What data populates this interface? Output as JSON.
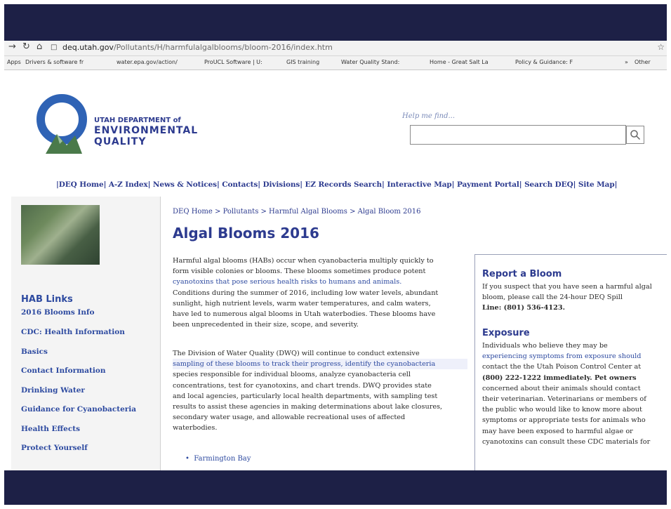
{
  "browser": {
    "url_host": "deq.utah.gov",
    "url_path": "/Pollutants/H/harmfulalgalblooms/bloom-2016/index.htm",
    "bookmarks": [
      "Apps",
      "Drivers & software fr",
      "water.epa.gov/action/",
      "ProUCL Software | U:",
      "GIS training",
      "Water Quality Stand:",
      "Home - Great Salt La",
      "Policy & Guidance: F",
      "»",
      "Other"
    ]
  },
  "header": {
    "org_line1": "UTAH DEPARTMENT of",
    "org_line2": "ENVIRONMENTAL",
    "org_line3": "QUALITY",
    "help_label": "Help me find...",
    "brand_color": "#2d3b8f"
  },
  "nav": {
    "items": [
      "DEQ Home",
      "A-Z Index",
      "News & Notices",
      "Contacts",
      "Divisions",
      "EZ Records Search",
      "Interactive Map",
      "Payment Portal",
      "Search DEQ",
      "Site Map"
    ]
  },
  "sidebar": {
    "title": "HAB Links",
    "links": [
      "2016 Blooms Info",
      "CDC: Health Information",
      "Basics",
      "Contact Information",
      "Drinking Water",
      "Guidance for Cyanobacteria",
      "Health Effects",
      "Protect Yourself"
    ]
  },
  "main": {
    "breadcrumb": "DEQ Home > Pollutants > Harmful Algal Blooms > Algal Bloom 2016",
    "title": "Algal Blooms 2016",
    "p1_lines": [
      "Harmful algal blooms (HABs) occur when cyanobacteria multiply quickly to",
      "form visible colonies or blooms. These blooms sometimes produce potent",
      "cyanotoxins that pose serious health risks to humans and animals.",
      "Conditions during the summer of 2016, including low water levels, abundant",
      "sunlight, high nutrient levels, warm water temperatures, and calm waters,",
      "have led to numerous algal blooms in Utah waterbodies. These blooms have",
      "been unprecedented in their size, scope, and severity."
    ],
    "p2_lines": [
      "The Division of Water Quality (DWQ) will continue to conduct extensive",
      "sampling of these blooms to track their progress, identify the cyanobacteria",
      "species responsible for individual blooms, analyze cyanobacteria cell",
      "concentrations, test for cyanotoxins, and chart trends. DWQ provides state",
      "and local agencies, particularly local health departments, with sampling test",
      "results to assist these agencies in making determinations about lake closures,",
      "secondary water usage, and allowable recreational uses of affected",
      "waterbodies."
    ],
    "bullets": [
      "Farmington Bay"
    ]
  },
  "aside": {
    "report_title": "Report a Bloom",
    "report_lines": [
      "If you suspect that you have seen a harmful algal",
      "bloom, please call the 24-hour DEQ Spill",
      "Line: (801) 536-4123."
    ],
    "exposure_title": "Exposure",
    "exposure_lines": [
      "Individuals who believe they may be",
      "experiencing symptoms from exposure should",
      "contact the the Utah Poison Control Center at",
      "(800) 222-1222 immediately. Pet owners",
      "concerned about their animals should contact",
      "their veterinarian. Veterinarians or members of",
      "the public who would like to know more about",
      "symptoms or appropriate tests for animals who",
      "may have been exposed to harmful algae or",
      "cyanotoxins can consult these CDC materials for"
    ]
  }
}
